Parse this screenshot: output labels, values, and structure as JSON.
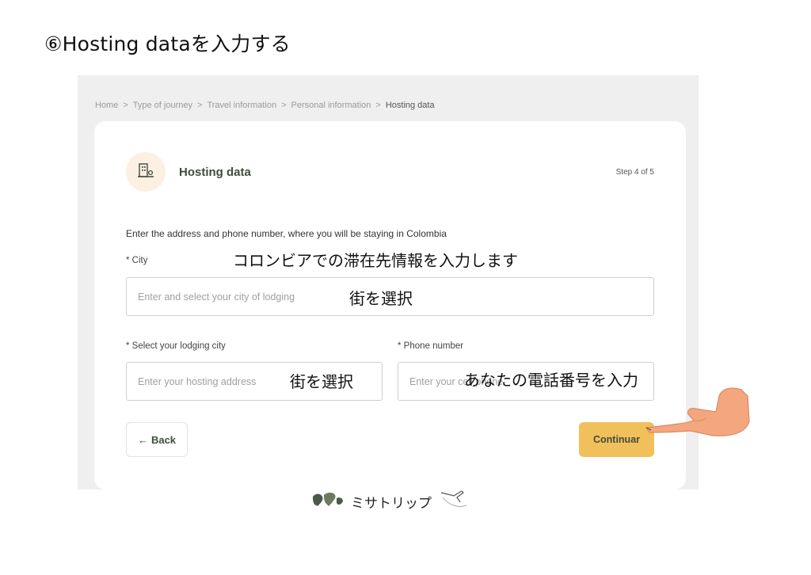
{
  "page_title": "⑥Hosting dataを入力する",
  "breadcrumb": {
    "items": [
      "Home",
      "Type of journey",
      "Travel information",
      "Personal information",
      "Hosting data"
    ],
    "separator": ">"
  },
  "card": {
    "icon": "building-icon",
    "title": "Hosting data",
    "step": "Step 4 of 5",
    "description": "Enter the address and phone number, where you will be staying in Colombia"
  },
  "form": {
    "city": {
      "label": "* City",
      "placeholder": "Enter and select your city of lodging"
    },
    "lodging_city": {
      "label": "* Select your lodging city",
      "placeholder": "Enter your hosting address"
    },
    "phone": {
      "label": "* Phone number",
      "placeholder": "Enter your cell phone"
    }
  },
  "buttons": {
    "back": {
      "label": "Back",
      "icon": "arrow-left-icon"
    },
    "continue": {
      "label": "Continuar"
    }
  },
  "annotations": {
    "city_note": "コロンビアでの滞在先情報を入力します",
    "city_input_note": "街を選択",
    "address_note": "街を選択",
    "phone_note": "あなたの電話番号を入力"
  },
  "footer": {
    "brand": "ミサトリップ"
  },
  "colors": {
    "accent_button": "#f2c05b",
    "title_green": "#3e4d3c",
    "icon_badge": "#fbf0e2",
    "hand": "#f4a77f"
  }
}
